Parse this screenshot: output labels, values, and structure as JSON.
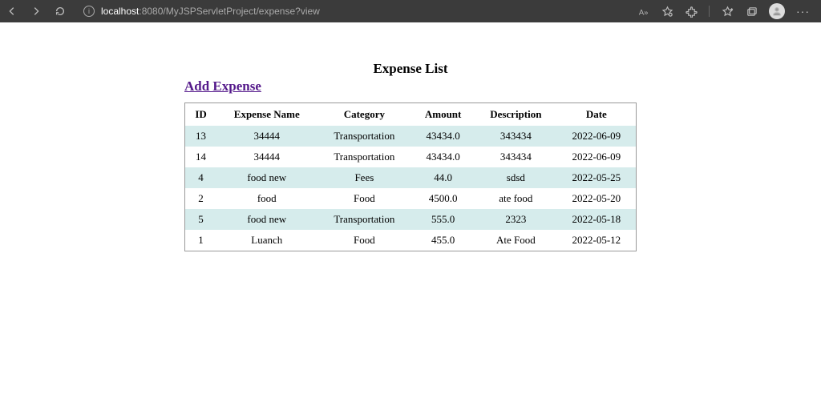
{
  "browser": {
    "url_host": "localhost",
    "url_port_path": ":8080/MyJSPServletProject/expense?view"
  },
  "page": {
    "title": "Expense List",
    "add_link_label": "Add Expense"
  },
  "table": {
    "headers": [
      "ID",
      "Expense Name",
      "Category",
      "Amount",
      "Description",
      "Date"
    ],
    "rows": [
      {
        "id": "13",
        "name": "34444",
        "category": "Transportation",
        "amount": "43434.0",
        "description": "343434",
        "date": "2022-06-09"
      },
      {
        "id": "14",
        "name": "34444",
        "category": "Transportation",
        "amount": "43434.0",
        "description": "343434",
        "date": "2022-06-09"
      },
      {
        "id": "4",
        "name": "food new",
        "category": "Fees",
        "amount": "44.0",
        "description": "sdsd",
        "date": "2022-05-25"
      },
      {
        "id": "2",
        "name": "food",
        "category": "Food",
        "amount": "4500.0",
        "description": "ate food",
        "date": "2022-05-20"
      },
      {
        "id": "5",
        "name": "food new",
        "category": "Transportation",
        "amount": "555.0",
        "description": "2323",
        "date": "2022-05-18"
      },
      {
        "id": "1",
        "name": "Luanch",
        "category": "Food",
        "amount": "455.0",
        "description": "Ate Food",
        "date": "2022-05-12"
      }
    ]
  }
}
